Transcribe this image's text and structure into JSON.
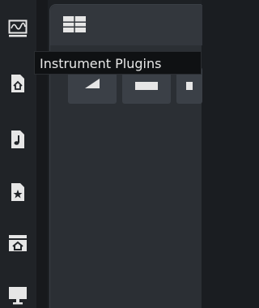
{
  "tooltip": {
    "text": "Instrument Plugins"
  },
  "rail": {
    "items": [
      {
        "name": "waveform-monitor-icon",
        "active": false
      },
      {
        "name": "instrument-plugins-icon",
        "active": true
      },
      {
        "name": "audio-file-icon",
        "active": false
      },
      {
        "name": "favorites-file-icon",
        "active": false
      },
      {
        "name": "home-folder-icon",
        "active": false
      },
      {
        "name": "computer-icon",
        "active": false
      }
    ]
  },
  "panel": {
    "header_icon": "grid-view-icon",
    "tools": [
      "play-tool",
      "rect-tool",
      "extra-tool"
    ]
  },
  "colors": {
    "rail_bg": "#202327",
    "panel_bg": "#2b2f34",
    "icon_fg": "#e6e6e6",
    "tooltip_bg": "#0f1113"
  }
}
